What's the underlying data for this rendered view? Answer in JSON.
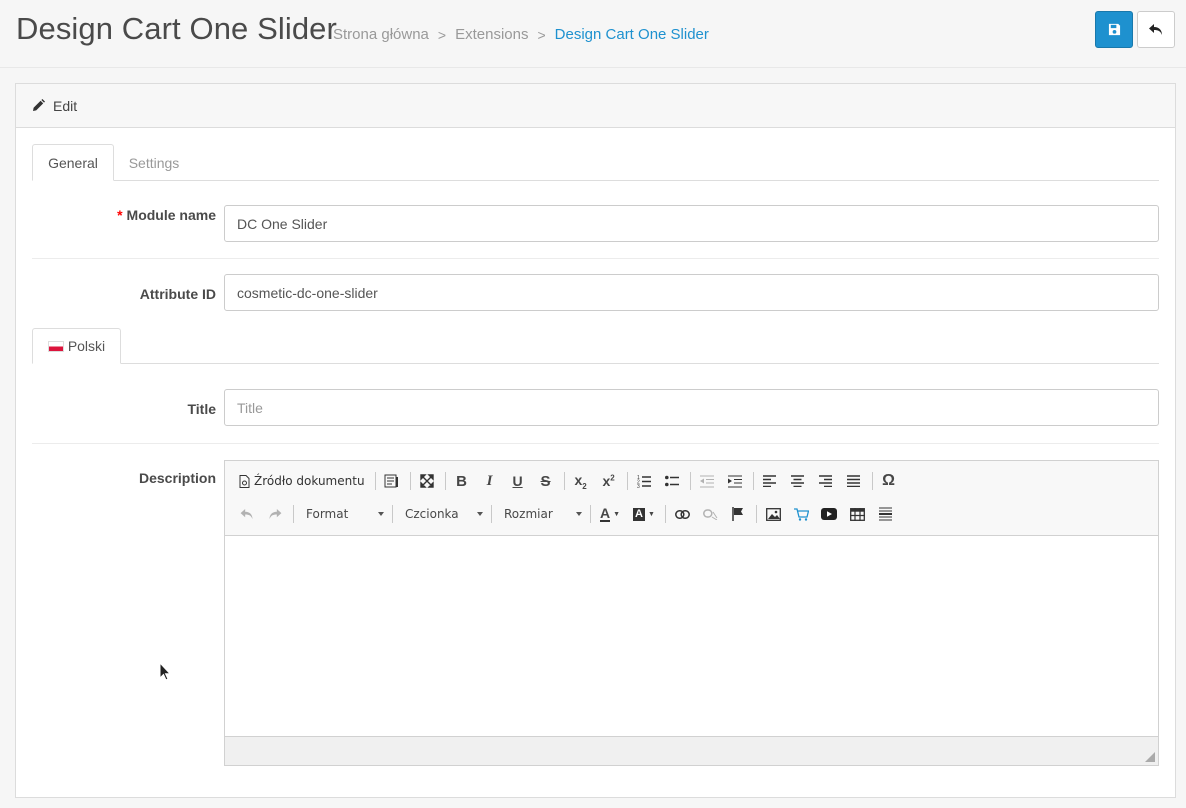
{
  "header": {
    "title": "Design Cart One Slider",
    "breadcrumb": [
      {
        "label": "Strona główna"
      },
      {
        "label": "Extensions"
      },
      {
        "label": "Design Cart One Slider"
      }
    ],
    "buttons": {
      "save_icon": "save-icon",
      "back_icon": "back-icon"
    }
  },
  "panel": {
    "heading": "Edit",
    "tabs": [
      {
        "label": "General",
        "active": true
      },
      {
        "label": "Settings",
        "active": false
      }
    ],
    "fields": {
      "module_name": {
        "label": "Module name",
        "required_mark": "*",
        "value": "DC One Slider"
      },
      "attribute_id": {
        "label": "Attribute ID",
        "value": "cosmetic-dc-one-slider"
      },
      "language_tab": {
        "label": "Polski",
        "flag": "pl-flag"
      },
      "title": {
        "label": "Title",
        "value": "",
        "placeholder": "Title"
      },
      "description": {
        "label": "Description"
      }
    },
    "editor": {
      "source_label": "Źródło dokumentu",
      "format_label": "Format",
      "font_label": "Czcionka",
      "size_label": "Rozmiar"
    }
  },
  "colors": {
    "primary": "#1e91cf",
    "required": "#ff0000",
    "muted": "#999999"
  }
}
